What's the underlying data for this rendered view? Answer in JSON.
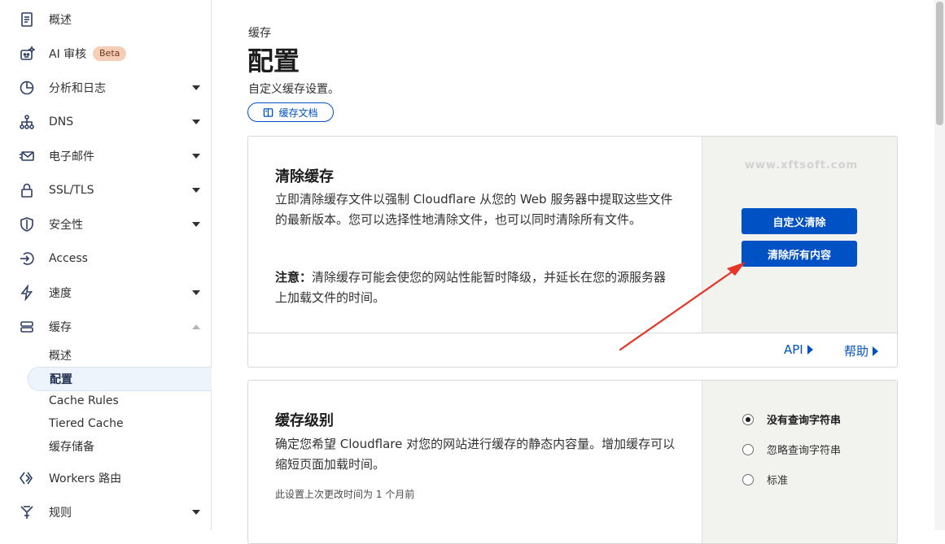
{
  "sidebar": {
    "items": [
      {
        "label": "概述",
        "icon": "document-icon"
      },
      {
        "label": "AI 审核",
        "icon": "robot-icon",
        "badge": "Beta"
      },
      {
        "label": "分析和日志",
        "icon": "pie-chart-icon"
      },
      {
        "label": "DNS",
        "icon": "network-icon"
      },
      {
        "label": "电子邮件",
        "icon": "envelope-icon"
      },
      {
        "label": "SSL/TLS",
        "icon": "lock-icon"
      },
      {
        "label": "安全性",
        "icon": "shield-icon"
      },
      {
        "label": "Access",
        "icon": "access-icon"
      },
      {
        "label": "速度",
        "icon": "lightning-icon"
      },
      {
        "label": "缓存",
        "icon": "cache-icon"
      },
      {
        "label": "Workers 路由",
        "icon": "workers-icon"
      },
      {
        "label": "规则",
        "icon": "rules-icon"
      }
    ],
    "cache_sub": [
      "概述",
      "配置",
      "Cache Rules",
      "Tiered Cache",
      "缓存储备"
    ]
  },
  "header": {
    "crumb": "缓存",
    "title": "配置",
    "description": "自定义缓存设置。",
    "docs_button": "缓存文档"
  },
  "purge_card": {
    "title": "清除缓存",
    "paragraph": "立即清除缓存文件以强制 Cloudflare 从您的 Web 服务器中提取这些文件的最新版本。您可以选择性地清除文件，也可以同时清除所有文件。",
    "note_label": "注意：",
    "note_text": "清除缓存可能会使您的网站性能暂时降级，并延长在您的源服务器上加载文件的时间。",
    "custom_button": "自定义清除",
    "purge_all_button": "清除所有内容",
    "api_link": "API",
    "help_link": "帮助",
    "watermark": "www.xftsoft.com"
  },
  "level_card": {
    "title": "缓存级别",
    "paragraph": "确定您希望 Cloudflare 对您的网站进行缓存的静态内容量。增加缓存可以缩短页面加载时间。",
    "meta": "此设置上次更改时间为 1 个月前",
    "options": [
      "没有查询字符串",
      "忽略查询字符串",
      "标准"
    ],
    "selected": "没有查询字符串"
  },
  "colors": {
    "accent": "#0051c3",
    "arrow": "#e53527"
  }
}
